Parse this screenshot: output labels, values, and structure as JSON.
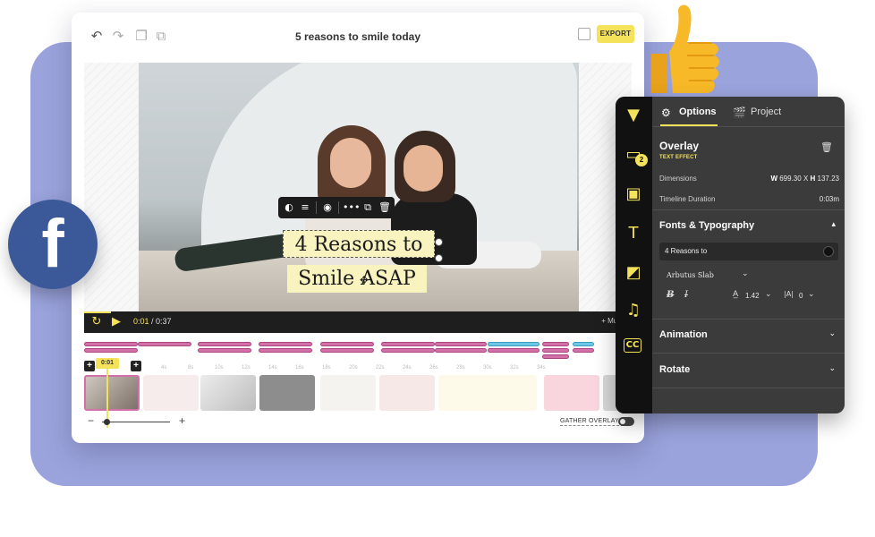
{
  "editor": {
    "title": "5 reasons to smile today",
    "export_label": "EXPORT",
    "overlay_line1": "4 Reasons to",
    "overlay_line2": "Smile ASAP",
    "time_current": "0:01",
    "time_sep": " / ",
    "time_total": "0:37",
    "music_label": "+ Music",
    "playhead_label": "0:01",
    "gather_label": "GATHER OVERLAYS",
    "zoom_minus": "−",
    "zoom_plus": "+",
    "ruler": [
      "0s",
      "4s",
      "8s",
      "10s",
      "12s",
      "14s",
      "16s",
      "18s",
      "20s",
      "22s",
      "24s",
      "26s",
      "28s",
      "30s",
      "32s",
      "34s"
    ]
  },
  "panel": {
    "tab_options": "Options",
    "tab_project": "Project",
    "section_title": "Overlay",
    "section_sub": "TEXT EFFECT",
    "dimensions_label": "Dimensions",
    "dim_w_label": "W",
    "dim_w_value": "699.30",
    "dim_x": "X",
    "dim_h_label": "H",
    "dim_h_value": "137.23",
    "duration_label": "Timeline Duration",
    "duration_value": "0:03m",
    "fonts_title": "Fonts & Typography",
    "text_value": "4 Reasons to",
    "font_name": "Arbutus Slab",
    "line_height": "1.42",
    "letter_spacing": "0",
    "animation_title": "Animation",
    "rotate_title": "Rotate",
    "folder_badge": "2"
  },
  "icons": {
    "undo": "undo-icon",
    "redo": "redo-icon",
    "facebook": "f"
  },
  "colors": {
    "accent": "#f4e35a",
    "backdrop": "#9aa3dc",
    "panel": "#3b3b3b",
    "track_pink": "#d470a8",
    "track_blue": "#6cc7e6",
    "facebook": "#3b5998"
  }
}
